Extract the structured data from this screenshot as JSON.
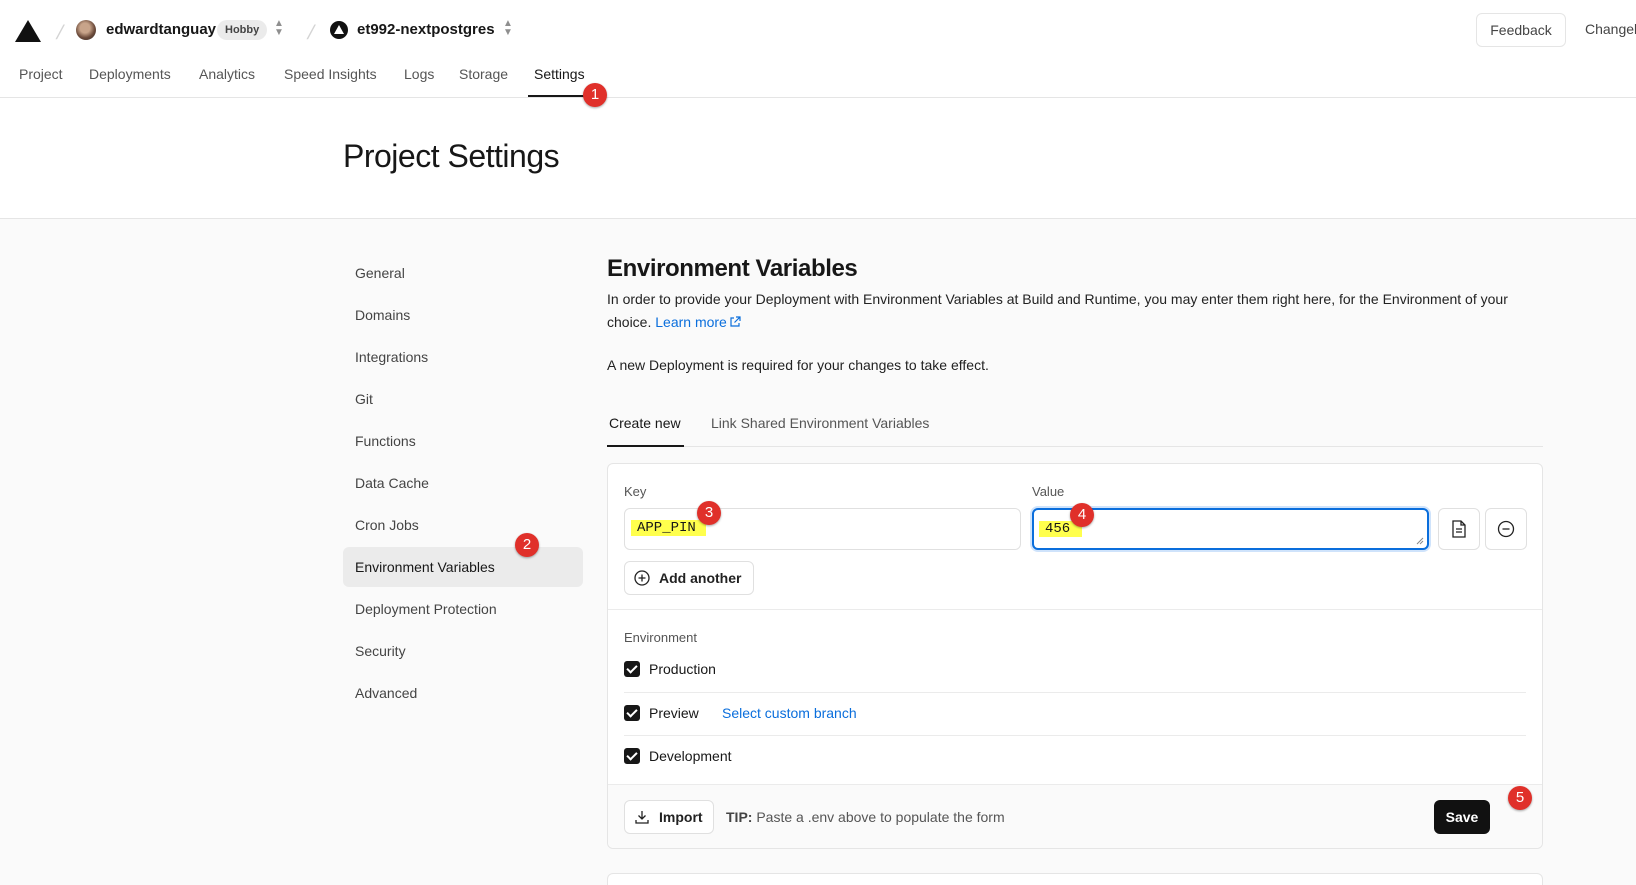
{
  "header": {
    "team_name": "edwardtanguay",
    "plan_badge": "Hobby",
    "project_name": "et992-nextpostgres",
    "feedback_label": "Feedback",
    "changelog_label": "Changelog"
  },
  "nav": {
    "tabs": [
      "Project",
      "Deployments",
      "Analytics",
      "Speed Insights",
      "Logs",
      "Storage",
      "Settings"
    ],
    "active": "Settings"
  },
  "page": {
    "title": "Project Settings"
  },
  "sidebar": {
    "items": [
      "General",
      "Domains",
      "Integrations",
      "Git",
      "Functions",
      "Data Cache",
      "Cron Jobs",
      "Environment Variables",
      "Deployment Protection",
      "Security",
      "Advanced"
    ],
    "active": "Environment Variables"
  },
  "env": {
    "title": "Environment Variables",
    "description": "In order to provide your Deployment with Environment Variables at Build and Runtime, you may enter them right here, for the Environment of your choice.",
    "learn_more": "Learn more",
    "note": "A new Deployment is required for your changes to take effect.",
    "tabs": [
      "Create new",
      "Link Shared Environment Variables"
    ],
    "key_label": "Key",
    "value_label": "Value",
    "key_value": "APP_PIN",
    "value_value": "456",
    "add_another": "Add another",
    "environment_label": "Environment",
    "environments": [
      {
        "name": "Production",
        "checked": true
      },
      {
        "name": "Preview",
        "checked": true,
        "link": "Select custom branch"
      },
      {
        "name": "Development",
        "checked": true
      }
    ],
    "import_label": "Import",
    "tip_bold": "TIP:",
    "tip_text": "Paste a .env above to populate the form",
    "save_label": "Save"
  },
  "markers": [
    "1",
    "2",
    "3",
    "4",
    "5"
  ],
  "colors": {
    "accent": "#0a6edc",
    "marker": "#e0302a",
    "highlight": "#ffff4d",
    "primary": "#111111"
  }
}
